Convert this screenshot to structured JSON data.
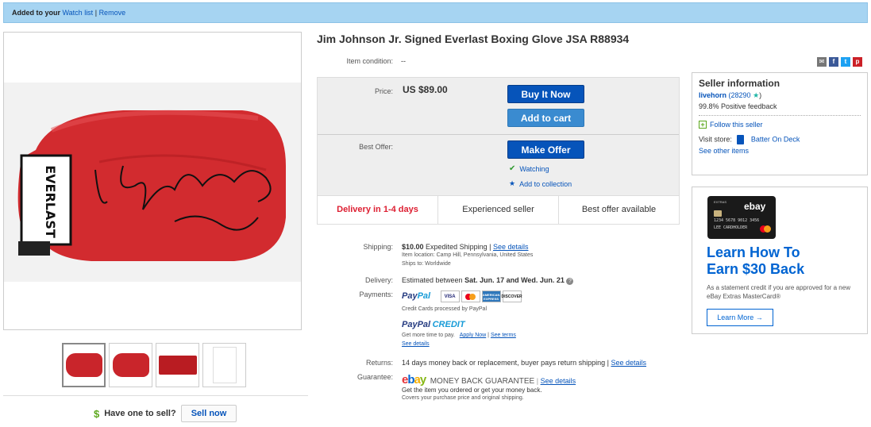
{
  "watchbar": {
    "added_text": "Added to your",
    "watch_link": "Watch list",
    "separator": "|",
    "remove_link": "Remove"
  },
  "listing": {
    "title": "Jim Johnson Jr. Signed Everlast Boxing Glove JSA R88934",
    "condition_label": "Item condition:",
    "condition_value": "--",
    "glove_brand_text": "EVERLAST"
  },
  "buy": {
    "price_label": "Price:",
    "price": "US $89.00",
    "buy_now": "Buy It Now",
    "add_cart": "Add to cart",
    "offer_label": "Best Offer:",
    "make_offer": "Make Offer",
    "watching": "Watching",
    "add_collection": "Add to collection",
    "badges": [
      "Delivery in 1-4 days",
      "Experienced seller",
      "Best offer available"
    ]
  },
  "shipping": {
    "label": "Shipping:",
    "cost": "$10.00",
    "method": "Expedited Shipping",
    "see_details": "See details",
    "location": "Item location:  Camp Hill, Pennsylvania, United States",
    "ships_to": "Ships to:  Worldwide"
  },
  "delivery": {
    "label": "Delivery:",
    "text": "Estimated between",
    "dates": "Sat. Jun. 17 and Wed. Jun. 21"
  },
  "payments": {
    "label": "Payments:",
    "paypal_a": "Pay",
    "paypal_b": "Pal",
    "cards": [
      "VISA",
      "",
      "AMERICAN EXPRESS",
      "DISCOVER"
    ],
    "processed": "Credit Cards processed by PayPal",
    "credit_a": "PayPal",
    "credit_b": "CREDIT",
    "more_time": "Get more time to pay.",
    "apply_now": "Apply Now",
    "see_terms": "See terms",
    "see_details": "See details"
  },
  "returns": {
    "label": "Returns:",
    "text": "14 days money back or replacement, buyer pays return shipping",
    "see_details": "See details"
  },
  "guarantee": {
    "label": "Guarantee:",
    "logo": [
      "e",
      "b",
      "a",
      "y"
    ],
    "mbg": "MONEY BACK GUARANTEE",
    "see_details": "See details",
    "line1": "Get the item you ordered or get your money back.",
    "line2": "Covers your purchase price and original shipping."
  },
  "seller": {
    "heading": "Seller information",
    "name": "livehorn",
    "score": "(28290",
    "score_end": ")",
    "feedback": "99.8% Positive feedback",
    "follow": "Follow this seller",
    "visit_label": "Visit store:",
    "store_name": "Batter On Deck",
    "other_items": "See other items"
  },
  "ad": {
    "card_label": "EXTRAS",
    "card_logo": "ebay",
    "card_number": "1234 5678 9012 3456",
    "card_name": "LEE CARDHOLDER",
    "headline1": "Learn How To",
    "headline2": "Earn $30 Back",
    "body": "As a statement credit if you are approved for a new eBay Extras MasterCard®",
    "cta": "Learn More →"
  },
  "sell": {
    "question": "Have one to sell?",
    "button": "Sell now"
  },
  "colors": {
    "link": "#0654ba",
    "watchbar_bg": "#a6d4f2",
    "button_dark": "#0654ba",
    "button_light": "#3a8bd0",
    "delivery_red": "#dd1e31"
  }
}
